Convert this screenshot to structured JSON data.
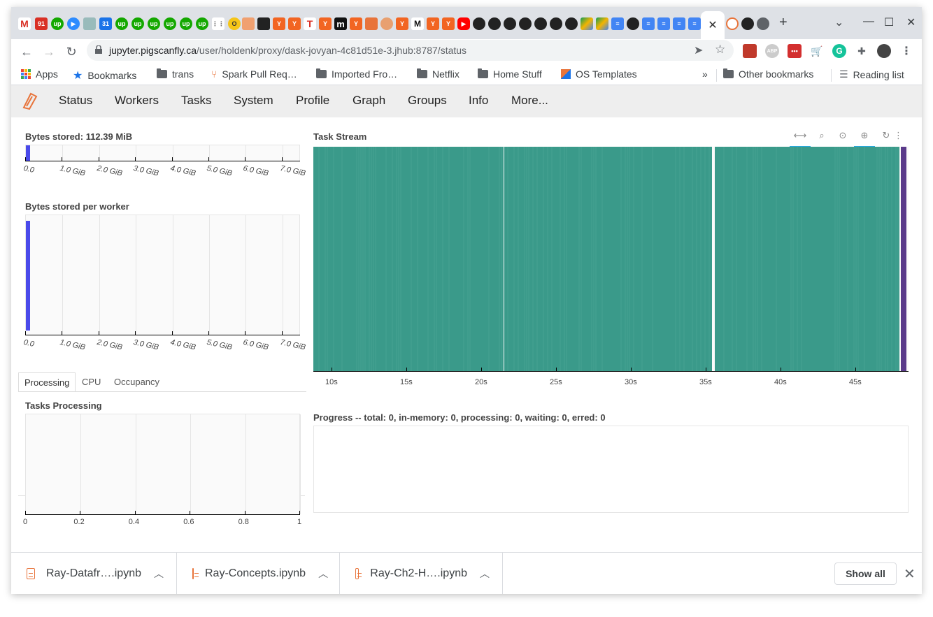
{
  "browser": {
    "tab_icons": [
      "gmail-icon",
      "calendar-91-icon",
      "upwork-icon",
      "zoom-icon",
      "octo-icon",
      "calendar-31-icon",
      "upwork-icon",
      "upwork-icon",
      "upwork-icon",
      "upwork-icon",
      "upwork-icon",
      "upwork-icon",
      "slack-icon",
      "opera-icon",
      "swirl-icon",
      "black-icon",
      "y-icon",
      "y-icon",
      "t-icon",
      "y-icon",
      "m-icon",
      "y-icon",
      "bookmark-icon",
      "circle-icon",
      "y-icon",
      "medium-icon",
      "y-icon",
      "y-icon",
      "youtube-icon",
      "github-icon",
      "github-icon",
      "github-icon",
      "github-icon",
      "github-icon",
      "github-icon",
      "github-icon",
      "drive-icon",
      "drive-icon",
      "docs-icon",
      "github-icon",
      "docs-icon",
      "docs-icon",
      "docs-icon"
    ],
    "tab_badges": {
      "calendar_91": "91",
      "calendar_31": "31",
      "upwork": "up",
      "y": "Y",
      "t": "T",
      "m": "m"
    },
    "url_host": "jupyter.pigscanfly.ca",
    "url_path": "/user/holdenk/proxy/dask-jovyan-4c81d51e-3.jhub:8787/status",
    "extension_abp": "ABP",
    "bookmarks": [
      "Apps",
      "Bookmarks",
      "trans",
      "Spark Pull Req…",
      "Imported Fro…",
      "Netflix",
      "Home Stuff",
      "OS Templates"
    ],
    "bookmarks_overflow": "»",
    "other_bookmarks": "Other bookmarks",
    "reading_list": "Reading list"
  },
  "dask_nav": [
    "Status",
    "Workers",
    "Tasks",
    "System",
    "Profile",
    "Graph",
    "Groups",
    "Info",
    "More..."
  ],
  "panels": {
    "bytes_stored": {
      "title": "Bytes stored: 112.39 MiB",
      "ticks": [
        "0.0",
        "1.0 GiB",
        "2.0 GiB",
        "3.0 GiB",
        "4.0 GiB",
        "5.0 GiB",
        "6.0 GiB",
        "7.0 GiB"
      ],
      "value_gib": 0.11
    },
    "bytes_per_worker": {
      "title": "Bytes stored per worker",
      "ticks": [
        "0.0",
        "1.0 GiB",
        "2.0 GiB",
        "3.0 GiB",
        "4.0 GiB",
        "5.0 GiB",
        "6.0 GiB",
        "7.0 GiB"
      ],
      "value_gib": 0.11
    },
    "tabs": [
      "Processing",
      "CPU",
      "Occupancy"
    ],
    "tasks_processing": {
      "title": "Tasks Processing",
      "ticks": [
        "0",
        "0.2",
        "0.4",
        "0.6",
        "0.8",
        "1"
      ]
    },
    "task_stream": {
      "title": "Task Stream",
      "ticks": [
        "10s",
        "15s",
        "20s",
        "25s",
        "30s",
        "35s",
        "40s",
        "45s"
      ],
      "color": "#3a9a8a"
    },
    "progress": {
      "title": "Progress -- total: 0, in-memory: 0, processing: 0, waiting: 0, erred: 0"
    }
  },
  "downloads": {
    "files": [
      "Ray-Datafr….ipynb",
      "Ray-Concepts.ipynb",
      "Ray-Ch2-H….ipynb"
    ],
    "show_all": "Show all"
  },
  "colors": {
    "bar_blue": "#4a4aea",
    "stream_teal": "#3a9a8a",
    "stream_purple": "#5a3a8a"
  }
}
